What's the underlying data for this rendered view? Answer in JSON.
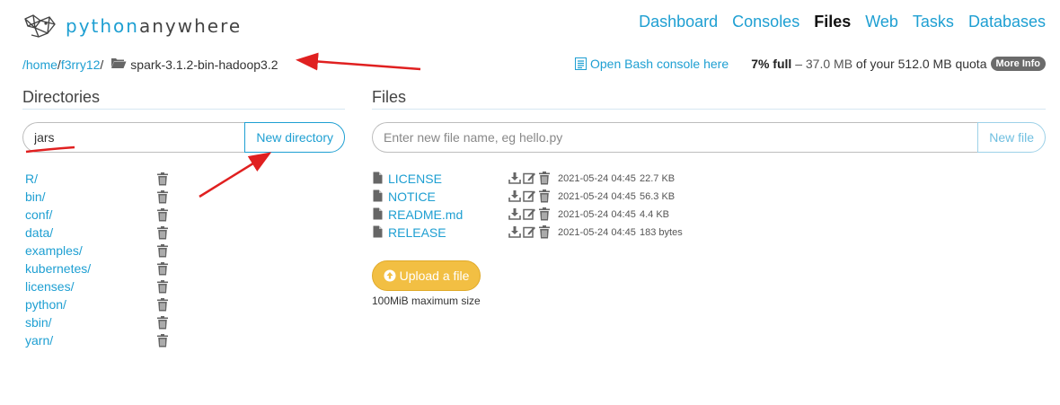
{
  "header": {
    "logo_part1": "python",
    "logo_part2": "anywhere",
    "nav": [
      {
        "label": "Dashboard",
        "active": false
      },
      {
        "label": "Consoles",
        "active": false
      },
      {
        "label": "Files",
        "active": true
      },
      {
        "label": "Web",
        "active": false
      },
      {
        "label": "Tasks",
        "active": false
      },
      {
        "label": "Databases",
        "active": false
      }
    ]
  },
  "breadcrumb": {
    "home": "/home",
    "sep1": "/",
    "user": "f3rry12",
    "sep2": "/",
    "current": "spark-3.1.2-bin-hadoop3.2"
  },
  "bash_console": {
    "label": "Open Bash console here",
    "icon": "terminal-icon"
  },
  "quota": {
    "percent_full": "7% full",
    "dash": " – ",
    "used": "37.0 MB",
    "middle": " of your ",
    "total": "512.0 MB",
    "suffix": " quota",
    "more_info": "More Info"
  },
  "directories": {
    "title": "Directories",
    "input_value": "jars",
    "button": "New directory",
    "items": [
      "R/",
      "bin/",
      "conf/",
      "data/",
      "examples/",
      "kubernetes/",
      "licenses/",
      "python/",
      "sbin/",
      "yarn/"
    ]
  },
  "files": {
    "title": "Files",
    "placeholder": "Enter new file name, eg hello.py",
    "button": "New file",
    "items": [
      {
        "name": "LICENSE",
        "date": "2021-05-24 04:45",
        "size": "22.7 KB"
      },
      {
        "name": "NOTICE",
        "date": "2021-05-24 04:45",
        "size": "56.3 KB"
      },
      {
        "name": "README.md",
        "date": "2021-05-24 04:45",
        "size": "4.4 KB"
      },
      {
        "name": "RELEASE",
        "date": "2021-05-24 04:45",
        "size": "183 bytes"
      }
    ],
    "upload_button": "Upload a file",
    "upload_note": "100MiB maximum size"
  },
  "colors": {
    "accent": "#1e9fd2",
    "upload": "#f2bf43",
    "annotation": "#e02020"
  }
}
